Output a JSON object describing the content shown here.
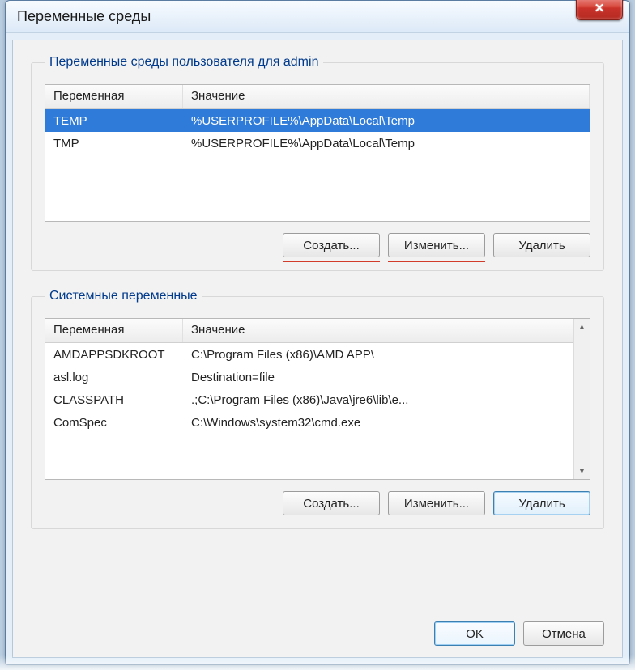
{
  "window": {
    "title": "Переменные среды"
  },
  "user_vars": {
    "legend": "Переменные среды пользователя для admin",
    "columns": {
      "name": "Переменная",
      "value": "Значение"
    },
    "rows": [
      {
        "name": "TEMP",
        "value": "%USERPROFILE%\\AppData\\Local\\Temp",
        "selected": true
      },
      {
        "name": "TMP",
        "value": "%USERPROFILE%\\AppData\\Local\\Temp",
        "selected": false
      }
    ],
    "buttons": {
      "create": "Создать...",
      "edit": "Изменить...",
      "delete": "Удалить"
    }
  },
  "system_vars": {
    "legend": "Системные переменные",
    "columns": {
      "name": "Переменная",
      "value": "Значение"
    },
    "rows": [
      {
        "name": "AMDAPPSDKROOT",
        "value": "C:\\Program Files (x86)\\AMD APP\\"
      },
      {
        "name": "asl.log",
        "value": "Destination=file"
      },
      {
        "name": "CLASSPATH",
        "value": ".;C:\\Program Files (x86)\\Java\\jre6\\lib\\e..."
      },
      {
        "name": "ComSpec",
        "value": "C:\\Windows\\system32\\cmd.exe"
      }
    ],
    "buttons": {
      "create": "Создать...",
      "edit": "Изменить...",
      "delete": "Удалить"
    }
  },
  "footer": {
    "ok": "OK",
    "cancel": "Отмена"
  }
}
